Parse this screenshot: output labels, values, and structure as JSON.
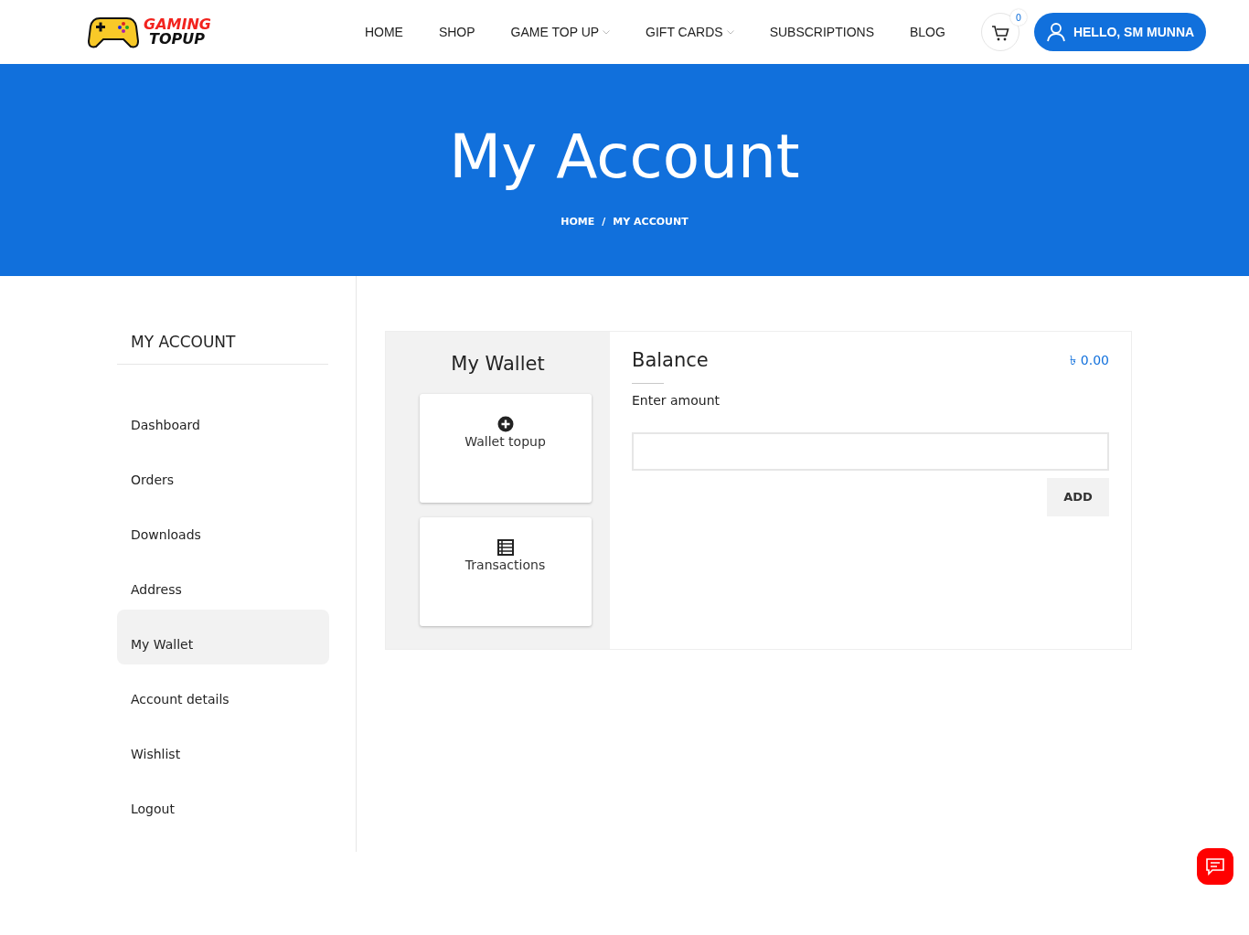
{
  "logo": {
    "line_1": "GAMING",
    "line_2": "TOPUP"
  },
  "nav": [
    {
      "label": "HOME",
      "dropdown": false
    },
    {
      "label": "SHOP",
      "dropdown": false
    },
    {
      "label": "GAME TOP UP",
      "dropdown": true
    },
    {
      "label": "GIFT CARDS",
      "dropdown": true
    },
    {
      "label": "SUBSCRIPTIONS",
      "dropdown": false
    },
    {
      "label": "BLOG",
      "dropdown": false
    }
  ],
  "cart": {
    "count": "0"
  },
  "user_button": "HELLO, SM MUNNA",
  "hero": {
    "title": "My Account",
    "breadcrumb": [
      "HOME",
      "MY ACCOUNT"
    ],
    "separator": "/"
  },
  "sidebar": {
    "title": "MY ACCOUNT",
    "items": [
      {
        "label": "Dashboard",
        "selected": false
      },
      {
        "label": "Orders",
        "selected": false
      },
      {
        "label": "Downloads",
        "selected": false
      },
      {
        "label": "Address",
        "selected": false
      },
      {
        "label": "My Wallet",
        "selected": true
      },
      {
        "label": "Account details",
        "selected": false
      },
      {
        "label": "Wishlist",
        "selected": false
      },
      {
        "label": "Logout",
        "selected": false
      }
    ]
  },
  "wallet": {
    "title": "My Wallet",
    "tiles": [
      {
        "kind": "topup",
        "label": "Wallet topup"
      },
      {
        "kind": "transactions",
        "label": "Transactions"
      }
    ],
    "balance_label": "Balance",
    "balance": "৳ 0.00",
    "amount_label": "Enter amount",
    "add_button": "ADD"
  }
}
